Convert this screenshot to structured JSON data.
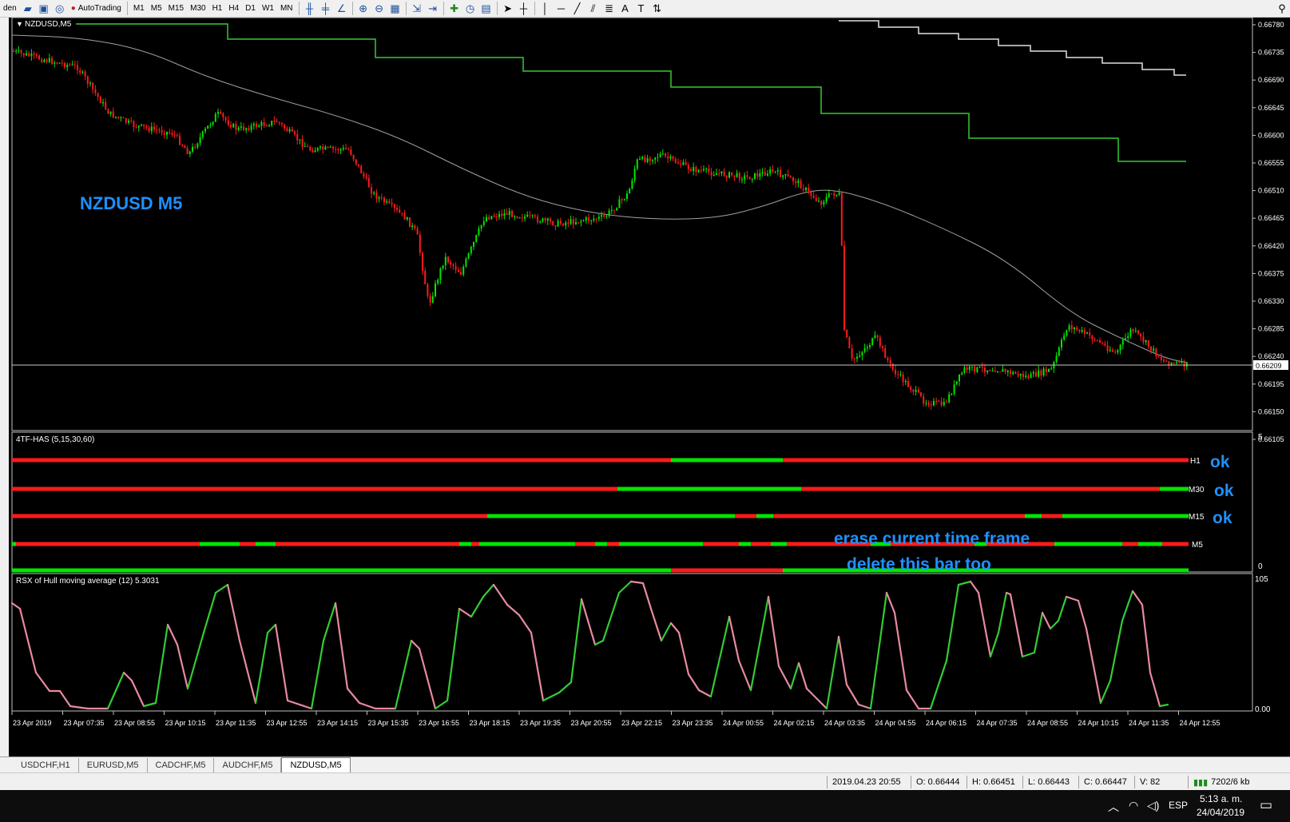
{
  "toolbar": {
    "left_label": "den",
    "autotrading": "AutoTrading",
    "timeframes": [
      "M1",
      "M5",
      "M15",
      "M30",
      "H1",
      "H4",
      "D1",
      "W1",
      "MN"
    ]
  },
  "chart": {
    "title": "NZDUSD,M5",
    "overlay_label": "NZDUSD   M5",
    "price_ticks": [
      "0.66780",
      "0.66735",
      "0.66690",
      "0.66645",
      "0.66600",
      "0.66555",
      "0.66510",
      "0.66465",
      "0.66420",
      "0.66375",
      "0.66330",
      "0.66285",
      "0.66240",
      "0.66195",
      "0.66150",
      "0.66105"
    ],
    "current_price": "0.66209",
    "time_ticks": [
      "23 Apr 2019",
      "23 Apr 07:35",
      "23 Apr 08:55",
      "23 Apr 10:15",
      "23 Apr 11:35",
      "23 Apr 12:55",
      "23 Apr 14:15",
      "23 Apr 15:35",
      "23 Apr 16:55",
      "23 Apr 18:15",
      "23 Apr 19:35",
      "23 Apr 20:55",
      "23 Apr 22:15",
      "23 Apr 23:35",
      "24 Apr 00:55",
      "24 Apr 02:15",
      "24 Apr 03:35",
      "24 Apr 04:55",
      "24 Apr 06:15",
      "24 Apr 07:35",
      "24 Apr 08:55",
      "24 Apr 10:15",
      "24 Apr 11:35",
      "24 Apr 12:55"
    ]
  },
  "indicator1": {
    "title": "4TF-HAS (5,15,30,60)",
    "scale_top": "5",
    "scale_bottom": "0",
    "rows": [
      {
        "label": "H1",
        "note": "ok"
      },
      {
        "label": "M30",
        "note": "ok"
      },
      {
        "label": "M15",
        "note": "ok"
      },
      {
        "label": "M5",
        "note": ""
      }
    ],
    "annotation1": "erase current time frame",
    "annotation2": "delete this bar too"
  },
  "indicator2": {
    "title": "RSX of Hull moving average (12) 5.3031",
    "scale_top": "105",
    "scale_bottom": "0.00"
  },
  "tabs": [
    "USDCHF,H1",
    "EURUSD,M5",
    "CADCHF,M5",
    "AUDCHF,M5",
    "NZDUSD,M5"
  ],
  "active_tab": "NZDUSD,M5",
  "status": {
    "datetime": "2019.04.23 20:55",
    "open": "O: 0.66444",
    "high": "H: 0.66451",
    "low": "L: 0.66443",
    "close": "C: 0.66447",
    "volume": "V: 82",
    "traffic": "7202/6 kb"
  },
  "taskbar": {
    "lang": "ESP",
    "time": "5:13 a. m.",
    "date": "24/04/2019"
  },
  "colors": {
    "bull": "#00e600",
    "bear": "#ff1a1a",
    "ma": "#a0a0a0",
    "resist_green": "#33cc33",
    "resist_white": "#e0e0e0",
    "annotation": "#1e90ff",
    "rsx_up": "#33cc33",
    "rsx_down": "#e88aa0"
  }
}
